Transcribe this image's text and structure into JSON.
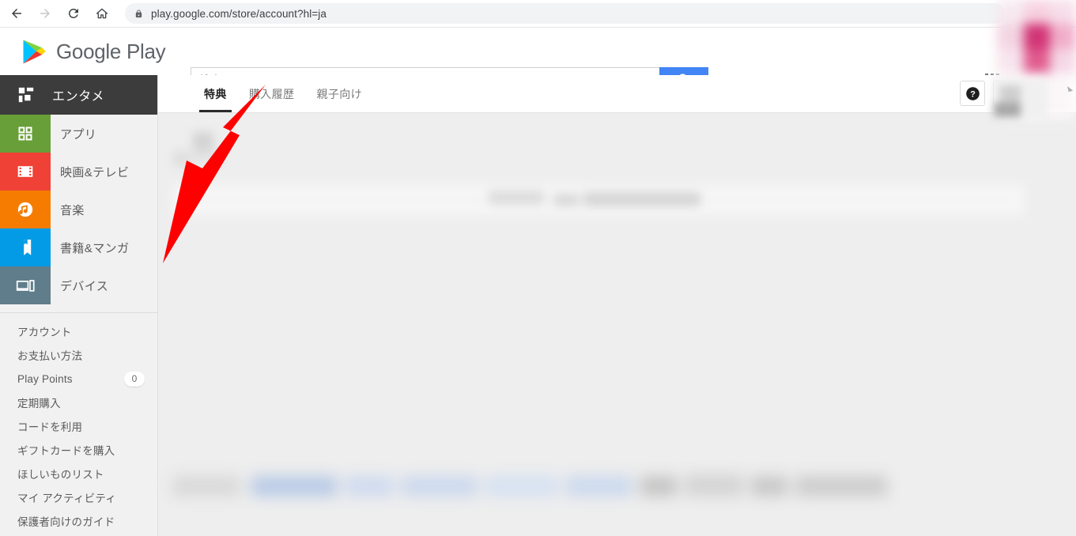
{
  "browser": {
    "url": "play.google.com/store/account?hl=ja",
    "back_label": "戻る",
    "forward_label": "進む",
    "reload_label": "再読み込み",
    "home_label": "ホーム",
    "lock_icon": "lock-icon",
    "back_icon": "arrow-left-icon",
    "forward_icon": "arrow-right-icon",
    "reload_icon": "reload-icon",
    "home_icon": "home-icon"
  },
  "header": {
    "brand": "Google Play",
    "logo_icon": "google-play-triangle-icon",
    "apps_grid_icon": "apps-grid-icon"
  },
  "search": {
    "placeholder": "検索",
    "value": "",
    "button_icon": "search-icon"
  },
  "sidebar": {
    "section_title": "エンタメ",
    "section_icon": "grid-tiles-icon",
    "categories": [
      {
        "label": "アプリ",
        "icon": "apps-squares-icon",
        "color": "#689F38"
      },
      {
        "label": "映画&テレビ",
        "icon": "film-strip-icon",
        "color": "#EF4135"
      },
      {
        "label": "音楽",
        "icon": "music-note-icon",
        "color": "#F57C00"
      },
      {
        "label": "書籍&マンガ",
        "icon": "book-icon",
        "color": "#039BE5"
      },
      {
        "label": "デバイス",
        "icon": "devices-icon",
        "color": "#607D8B"
      }
    ],
    "menu": [
      {
        "label": "アカウント",
        "badge": null
      },
      {
        "label": "お支払い方法",
        "badge": null
      },
      {
        "label": "Play Points",
        "badge": "0"
      },
      {
        "label": "定期購入",
        "badge": null
      },
      {
        "label": "コードを利用",
        "badge": null
      },
      {
        "label": "ギフトカードを購入",
        "badge": null
      },
      {
        "label": "ほしいものリスト",
        "badge": null
      },
      {
        "label": "マイ アクティビティ",
        "badge": null
      },
      {
        "label": "保護者向けのガイド",
        "badge": null
      }
    ]
  },
  "main": {
    "tabs": [
      {
        "label": "特典",
        "active": true
      },
      {
        "label": "購入履歴",
        "active": false
      },
      {
        "label": "親子向け",
        "active": false
      }
    ],
    "help_icon": "help-question-icon",
    "account_button_label": ""
  },
  "annotation": {
    "type": "arrow",
    "color": "#FF0000",
    "points_to": "購入履歴",
    "tip": [
      146,
      12
    ],
    "tail": [
      16,
      238
    ]
  },
  "colors": {
    "accent_blue": "#4285f4",
    "sidebar_bg": "#f1f1f1",
    "content_bg": "#eeeeee",
    "section_header_bg": "#3c3c3c",
    "tab_underline": "#2b2b2b",
    "annotation_red": "#FF0000"
  }
}
